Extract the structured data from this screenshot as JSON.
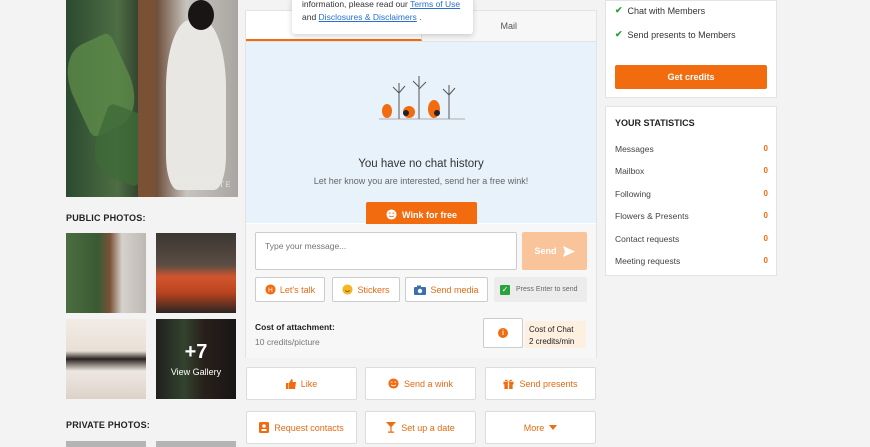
{
  "left": {
    "main_photo_watermark": "BRAVODATE",
    "public_photos_title": "PUBLIC PHOTOS:",
    "more_count": "+7",
    "view_gallery": "View Gallery",
    "private_photos_title": "PRIVATE PHOTOS:"
  },
  "popup": {
    "line1_prefix": "information, please read our ",
    "terms_link": "Terms of Use",
    "line2_prefix": "and ",
    "disclosures_link": "Disclosures & Disclaimers",
    "line2_suffix": " ."
  },
  "tabs": [
    {
      "label": "",
      "active": true
    },
    {
      "label": "Mail",
      "active": false
    }
  ],
  "empty_state": {
    "title": "You have no chat history",
    "subtitle": "Let her know you are interested, send her a free wink!",
    "wink_button": "Wink for free"
  },
  "compose": {
    "placeholder": "Type your message...",
    "send_label": "Send",
    "lets_talk": "Let's talk",
    "stickers": "Stickers",
    "send_media": "Send media",
    "press_enter": "Press Enter to send",
    "cost_title": "Cost of attachment:",
    "cost_value": "10 credits/picture",
    "chat_cost_title": "Cost of Chat",
    "chat_cost_value": "2 credits/min"
  },
  "actions": {
    "like": "Like",
    "send_wink": "Send a wink",
    "send_presents": "Send presents",
    "request_contacts": "Request contacts",
    "set_up_date": "Set up a date",
    "more": "More"
  },
  "features": {
    "chat": "Chat with Members",
    "presents": "Send presents to Members",
    "get_credits": "Get credits"
  },
  "stats": {
    "title": "YOUR STATISTICS",
    "rows": [
      {
        "label": "Messages",
        "value": "0"
      },
      {
        "label": "Mailbox",
        "value": "0"
      },
      {
        "label": "Following",
        "value": "0"
      },
      {
        "label": "Flowers & Presents",
        "value": "0"
      },
      {
        "label": "Contact requests",
        "value": "0"
      },
      {
        "label": "Meeting requests",
        "value": "0"
      }
    ]
  },
  "colors": {
    "accent": "#f26b0f",
    "success": "#2aa23d",
    "link": "#2a6fcf"
  }
}
